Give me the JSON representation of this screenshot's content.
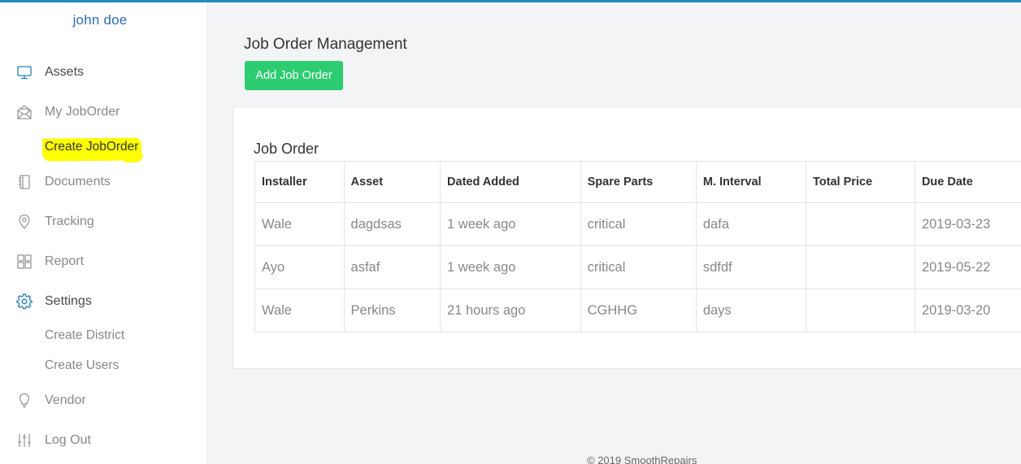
{
  "user": {
    "name": "john doe"
  },
  "sidebar": {
    "items": [
      {
        "label": "Assets",
        "icon": "monitor-icon"
      },
      {
        "label": "My JobOrder",
        "icon": "envelope-open-icon"
      },
      {
        "label": "Create JobOrder",
        "icon": ""
      },
      {
        "label": "Documents",
        "icon": "notebook-icon"
      },
      {
        "label": "Tracking",
        "icon": "map-pin-icon"
      },
      {
        "label": "Report",
        "icon": "grid-icon"
      },
      {
        "label": "Settings",
        "icon": "gear-icon"
      },
      {
        "label": "Create District",
        "icon": ""
      },
      {
        "label": "Create Users",
        "icon": ""
      },
      {
        "label": "Vendor",
        "icon": "lightbulb-icon"
      },
      {
        "label": "Log Out",
        "icon": "sliders-icon"
      }
    ]
  },
  "main": {
    "title": "Job Order Management",
    "add_button": "Add Job Order",
    "card_title": "Job Order",
    "table": {
      "headers": [
        "Installer",
        "Asset",
        "Dated Added",
        "Spare Parts",
        "M. Interval",
        "Total Price",
        "Due Date"
      ],
      "rows": [
        [
          "Wale",
          "dagdsas",
          "1 week ago",
          "critical",
          "dafa",
          "",
          "2019-03-23"
        ],
        [
          "Ayo",
          "asfaf",
          "1 week ago",
          "critical",
          "sdfdf",
          "",
          "2019-05-22"
        ],
        [
          "Wale",
          "Perkins",
          "21 hours ago",
          "CGHHG",
          "days",
          "",
          "2019-03-20"
        ]
      ]
    }
  },
  "footer": {
    "text": "© 2019 SmoothRepairs"
  },
  "colors": {
    "accent": "#1f8bbd",
    "user_name": "#2b6eb1",
    "button": "#2ecc71",
    "highlight": "#fdff00"
  }
}
